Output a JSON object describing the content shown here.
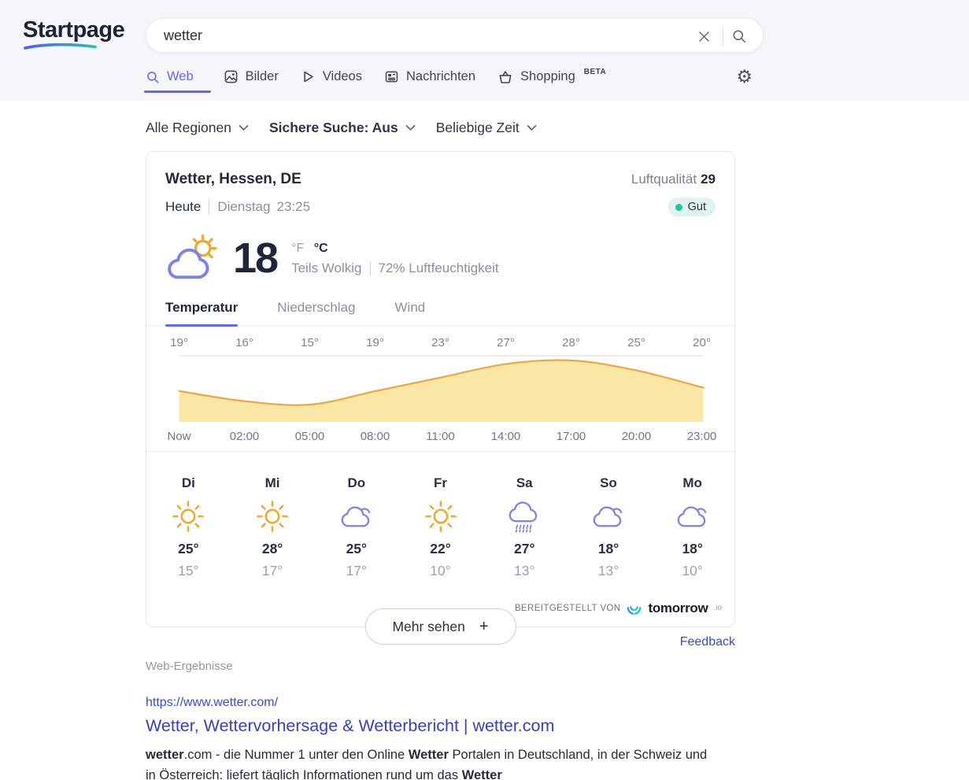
{
  "theme": {
    "accent": "#5f6cf0",
    "link": "#3a4cc7",
    "header_bg": "#f6f6fa",
    "badge_bg": "#dff4ee",
    "badge_dot": "#23c3a6",
    "sun": "#f5a728",
    "cloud": "#7b82ee"
  },
  "header": {
    "logo": "Startpage",
    "search": {
      "value": "wetter",
      "clear_icon": "x-icon",
      "submit_icon": "magnifier-icon"
    },
    "tabs": [
      {
        "label": "Web",
        "icon": "search-icon",
        "active": true
      },
      {
        "label": "Bilder",
        "icon": "image-icon",
        "active": false
      },
      {
        "label": "Videos",
        "icon": "play-icon",
        "active": false
      },
      {
        "label": "Nachrichten",
        "icon": "news-icon",
        "active": false
      },
      {
        "label": "Shopping",
        "icon": "basket-icon",
        "badge": "BETA",
        "active": false
      }
    ],
    "settings_icon": "gear-icon"
  },
  "filters": [
    {
      "label": "Alle Regionen"
    },
    {
      "label": "Sichere Suche: Aus"
    },
    {
      "label": "Beliebige Zeit"
    }
  ],
  "weather": {
    "title": "Wetter, Hessen, DE",
    "air_quality_label": "Luftqualität",
    "air_quality_value": "29",
    "air_quality_status": "Gut",
    "day_label": "Heute",
    "date_label": "Dienstag",
    "time_label": "23:25",
    "current": {
      "icon": "partly-cloudy-icon",
      "temp": "18",
      "unit_f": "°F",
      "unit_c": "°C",
      "condition": "Teils Wolkig",
      "humidity": "72% Luftfeuchtigkeit"
    },
    "view_tabs": [
      {
        "label": "Temperatur",
        "active": true
      },
      {
        "label": "Niederschlag",
        "active": false
      },
      {
        "label": "Wind",
        "active": false
      }
    ],
    "chart_data": {
      "type": "area",
      "title": "Stündlicher Temperaturverlauf",
      "x": [
        "Now",
        "02:00",
        "05:00",
        "08:00",
        "11:00",
        "14:00",
        "17:00",
        "20:00",
        "23:00"
      ],
      "values": [
        19,
        16,
        15,
        19,
        23,
        27,
        28,
        25,
        20
      ],
      "value_labels": [
        "19°",
        "16°",
        "15°",
        "19°",
        "23°",
        "27°",
        "28°",
        "25°",
        "20°"
      ],
      "unit": "°C",
      "ylim": [
        15,
        28
      ],
      "grid": false,
      "line_color": "#f0a63a",
      "fill_color": "#fae7a6",
      "axis_line_color": "#d9dbe3"
    },
    "days": [
      {
        "name": "Di",
        "icon": "sun-icon",
        "high": "25°",
        "low": "15°"
      },
      {
        "name": "Mi",
        "icon": "sun-icon",
        "high": "28°",
        "low": "17°"
      },
      {
        "name": "Do",
        "icon": "cloud-icon",
        "high": "25°",
        "low": "17°"
      },
      {
        "name": "Fr",
        "icon": "sun-icon",
        "high": "22°",
        "low": "10°"
      },
      {
        "name": "Sa",
        "icon": "rain-icon",
        "high": "27°",
        "low": "13°"
      },
      {
        "name": "So",
        "icon": "cloud-icon",
        "high": "18°",
        "low": "13°"
      },
      {
        "name": "Mo",
        "icon": "cloud-icon",
        "high": "18°",
        "low": "10°"
      }
    ],
    "more_button": {
      "label": "Mehr sehen",
      "plus": "+"
    },
    "provider": {
      "prefix": "BEREITGESTELLT VON",
      "name": "tomorrow",
      "suffix": ".io"
    },
    "feedback": "Feedback"
  },
  "results": {
    "section_label": "Web-Ergebnisse",
    "items": [
      {
        "url": "https://www.wetter.com/",
        "title": "Wetter, Wettervorhersage & Wetterbericht | wetter.com",
        "description_parts": [
          {
            "text": "wetter",
            "bold": true
          },
          {
            "text": ".com - die Nummer 1 unter den Online ",
            "bold": false
          },
          {
            "text": "Wetter",
            "bold": true
          },
          {
            "text": " Portalen in Deutschland, in der Schweiz und in Österreich: liefert täglich Informationen rund um das ",
            "bold": false
          },
          {
            "text": "Wetter",
            "bold": true
          }
        ]
      }
    ]
  }
}
